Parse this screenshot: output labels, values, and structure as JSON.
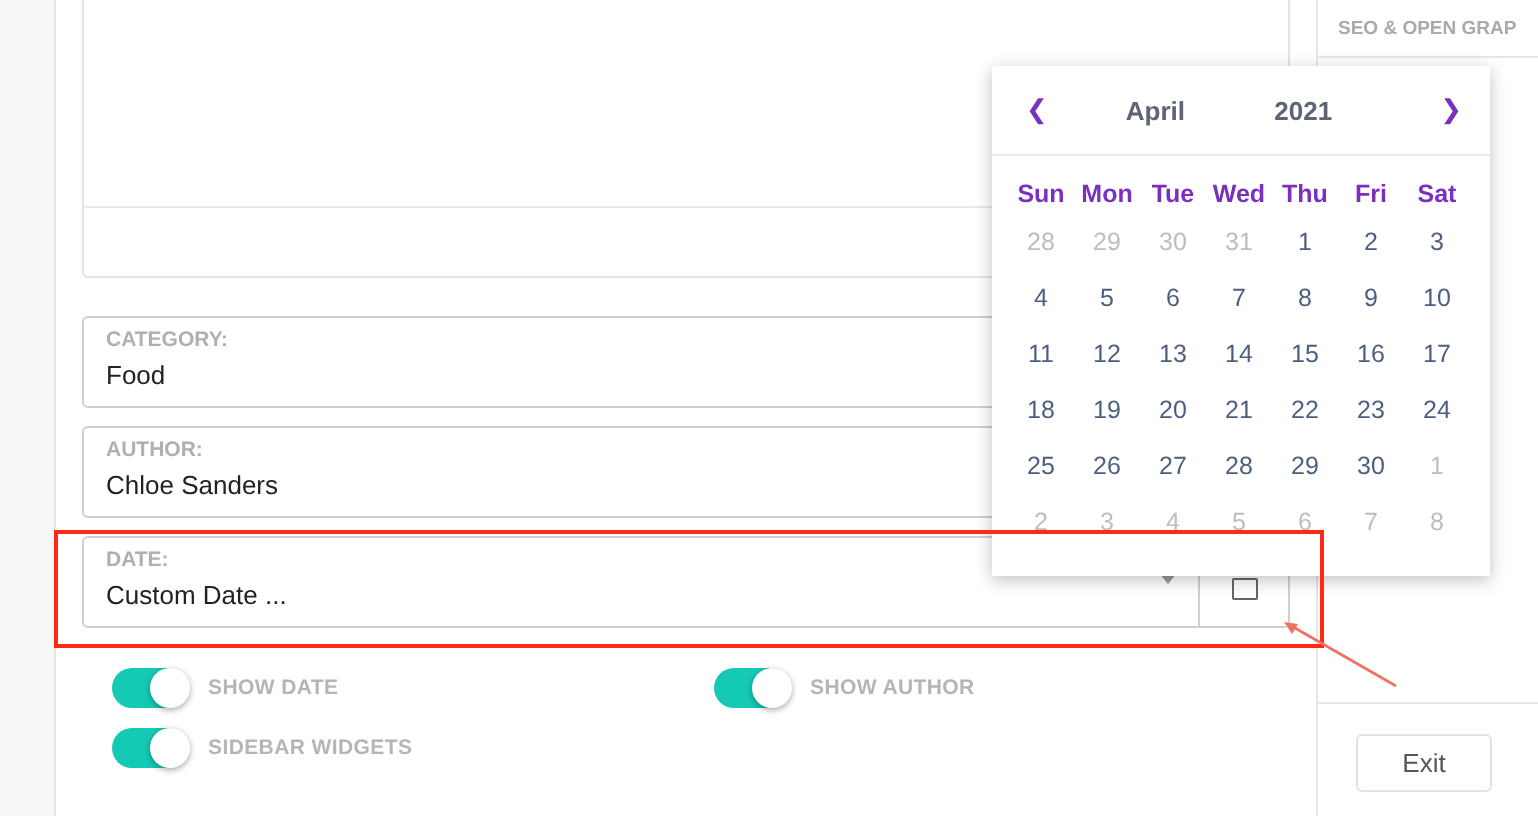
{
  "fields": [
    {
      "label": "CATEGORY:",
      "value": "Food",
      "kind": "select"
    },
    {
      "label": "AUTHOR:",
      "value": "Chloe Sanders",
      "kind": "select"
    },
    {
      "label": "DATE:",
      "value": "Custom Date ...",
      "kind": "date"
    }
  ],
  "toggles": [
    {
      "label": "SHOW DATE",
      "on": true
    },
    {
      "label": "SHOW AUTHOR",
      "on": true
    },
    {
      "label": "SIDEBAR WIDGETS",
      "on": true
    }
  ],
  "calendar": {
    "prev": "❮",
    "month": "April",
    "year": "2021",
    "next": "❯",
    "weekdays": [
      "Sun",
      "Mon",
      "Tue",
      "Wed",
      "Thu",
      "Fri",
      "Sat"
    ],
    "weeks": [
      [
        {
          "day": "28",
          "muted": true
        },
        {
          "day": "29",
          "muted": true
        },
        {
          "day": "30",
          "muted": true
        },
        {
          "day": "31",
          "muted": true
        },
        {
          "day": "1",
          "muted": false
        },
        {
          "day": "2",
          "muted": false
        },
        {
          "day": "3",
          "muted": false
        }
      ],
      [
        {
          "day": "4",
          "muted": false
        },
        {
          "day": "5",
          "muted": false
        },
        {
          "day": "6",
          "muted": false
        },
        {
          "day": "7",
          "muted": false
        },
        {
          "day": "8",
          "muted": false
        },
        {
          "day": "9",
          "muted": false
        },
        {
          "day": "10",
          "muted": false
        }
      ],
      [
        {
          "day": "11",
          "muted": false
        },
        {
          "day": "12",
          "muted": false
        },
        {
          "day": "13",
          "muted": false
        },
        {
          "day": "14",
          "muted": false
        },
        {
          "day": "15",
          "muted": false
        },
        {
          "day": "16",
          "muted": false
        },
        {
          "day": "17",
          "muted": false
        }
      ],
      [
        {
          "day": "18",
          "muted": false
        },
        {
          "day": "19",
          "muted": false
        },
        {
          "day": "20",
          "muted": false
        },
        {
          "day": "21",
          "muted": false
        },
        {
          "day": "22",
          "muted": false
        },
        {
          "day": "23",
          "muted": false
        },
        {
          "day": "24",
          "muted": false
        }
      ],
      [
        {
          "day": "25",
          "muted": false
        },
        {
          "day": "26",
          "muted": false
        },
        {
          "day": "27",
          "muted": false
        },
        {
          "day": "28",
          "muted": false
        },
        {
          "day": "29",
          "muted": false
        },
        {
          "day": "30",
          "muted": false
        },
        {
          "day": "1",
          "muted": true
        }
      ],
      [
        {
          "day": "2",
          "muted": true
        },
        {
          "day": "3",
          "muted": true
        },
        {
          "day": "4",
          "muted": true
        },
        {
          "day": "5",
          "muted": true
        },
        {
          "day": "6",
          "muted": true
        },
        {
          "day": "7",
          "muted": true
        },
        {
          "day": "8",
          "muted": true
        }
      ]
    ]
  },
  "right_panel": {
    "heading": "SEO & OPEN GRAP",
    "exit_button": "Exit"
  }
}
